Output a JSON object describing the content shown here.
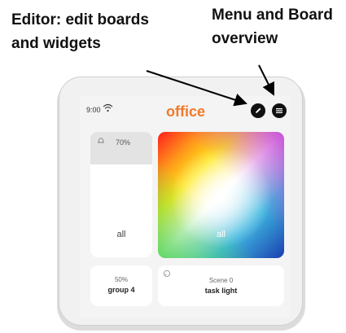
{
  "annotations": {
    "editor_line1": "Editor: edit boards",
    "editor_line2": "and widgets",
    "menu_line1": "Menu and Board",
    "menu_line2": "overview"
  },
  "status_bar": {
    "time": "9:00",
    "wifi_icon": "wifi-icon"
  },
  "board": {
    "title": "office",
    "title_color": "#f07a2a",
    "edit_icon": "pencil-icon",
    "menu_icon": "hamburger-menu-icon"
  },
  "widgets": {
    "group_slider": {
      "icon": "bell-icon",
      "percent": "70%",
      "label": "all"
    },
    "color_picker": {
      "label": "all"
    },
    "group4": {
      "percent": "50%",
      "name": "group 4"
    },
    "scene": {
      "icon": "scene-icon",
      "label": "Scene 0",
      "name": "task light"
    }
  }
}
